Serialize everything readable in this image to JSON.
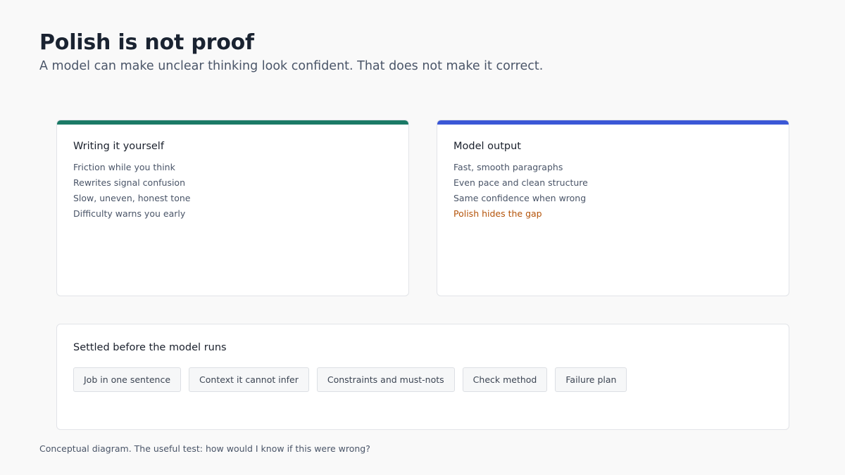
{
  "header": {
    "title": "Polish is not proof",
    "subtitle": "A model can make unclear thinking look confident. That does not make it correct."
  },
  "cards": [
    {
      "title": "Writing it yourself",
      "accent": "#1b7a66",
      "items": [
        "Friction while you think",
        "Rewrites signal confusion",
        "Slow, uneven, honest tone",
        "Difficulty warns you early"
      ]
    },
    {
      "title": "Model output",
      "accent": "#3b57d6",
      "items": [
        "Fast, smooth paragraphs",
        "Even pace and clean structure",
        "Same confidence when wrong",
        "Polish hides the gap"
      ],
      "warning_color": "#b45309"
    }
  ],
  "settled": {
    "title": "Settled before the model runs",
    "chips": [
      "Job in one sentence",
      "Context it cannot infer",
      "Constraints and must-nots",
      "Check method",
      "Failure plan"
    ]
  },
  "caption": "Conceptual diagram. The useful test: how would I know if this were wrong?"
}
